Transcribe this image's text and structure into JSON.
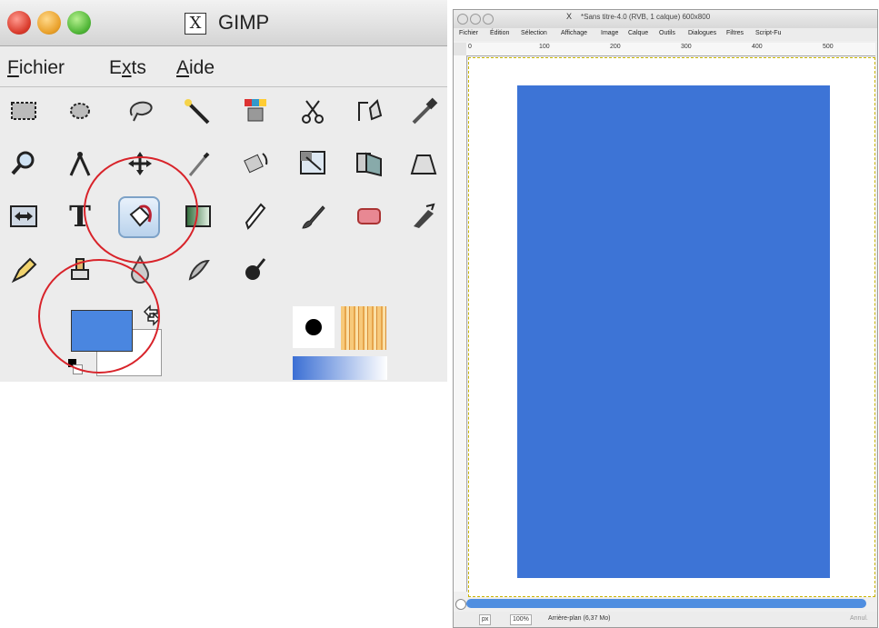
{
  "toolbox": {
    "title": "GIMP",
    "x_icon_text": "X",
    "menu": [
      {
        "label": "Fichier",
        "mnemonic_index": 0
      },
      {
        "label": "Exts",
        "mnemonic_index": 1
      },
      {
        "label": "Aide",
        "mnemonic_index": 0
      }
    ],
    "tools": [
      {
        "name": "rect-select-icon"
      },
      {
        "name": "ellipse-select-icon"
      },
      {
        "name": "free-select-icon"
      },
      {
        "name": "fuzzy-select-icon"
      },
      {
        "name": "select-by-color-icon"
      },
      {
        "name": "scissors-select-icon"
      },
      {
        "name": "paths-icon"
      },
      {
        "name": "color-picker-icon"
      },
      {
        "name": "zoom-icon"
      },
      {
        "name": "measure-icon"
      },
      {
        "name": "move-icon"
      },
      {
        "name": "crop-icon"
      },
      {
        "name": "rotate-icon"
      },
      {
        "name": "scale-icon"
      },
      {
        "name": "shear-icon"
      },
      {
        "name": "perspective-icon"
      },
      {
        "name": "flip-icon"
      },
      {
        "name": "text-icon"
      },
      {
        "name": "bucket-fill-icon"
      },
      {
        "name": "blend-icon"
      },
      {
        "name": "pencil-icon"
      },
      {
        "name": "paintbrush-icon"
      },
      {
        "name": "eraser-icon"
      },
      {
        "name": "airbrush-icon"
      },
      {
        "name": "ink-icon"
      },
      {
        "name": "clone-icon"
      },
      {
        "name": "blur-icon"
      },
      {
        "name": "smudge-icon"
      },
      {
        "name": "dodge-burn-icon"
      }
    ],
    "text_tool_glyph": "T",
    "foreground_color": "#4a86e0",
    "background_color": "#ffffff"
  },
  "image_window": {
    "title": "*Sans titre-4.0 (RVB, 1 calque) 600x800",
    "x_icon_text": "X",
    "menu": [
      "Fichier",
      "Édition",
      "Sélection",
      "Affichage",
      "Image",
      "Calque",
      "Outils",
      "Dialogues",
      "Filtres",
      "Script-Fu"
    ],
    "ruler_labels": [
      "0",
      "100",
      "200",
      "300",
      "400",
      "500"
    ],
    "fill_color": "#3d74d6",
    "status": {
      "unit": "px",
      "zoom": "100%",
      "layer_info": "Arrière-plan (6,37 Mo)",
      "cancel": "Annul."
    }
  }
}
